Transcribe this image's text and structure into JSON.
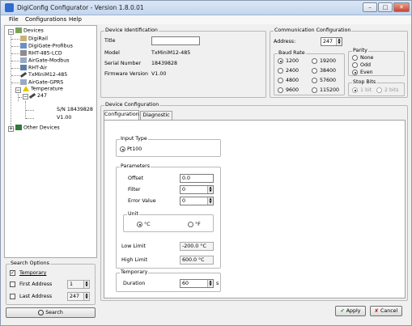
{
  "window": {
    "title": "DigiConfig Configurator - Version 1.8.0.01"
  },
  "menu": [
    "File",
    "Configurations",
    "Help"
  ],
  "tree": {
    "root": "Devices",
    "items": [
      "DigiRail",
      "DigiGate-Profibus",
      "RHT-485-LCD",
      "AirGate-Modbus",
      "RHT-Air",
      "TxMiniM12-485",
      "AirGate-GPRS"
    ],
    "temperature": "Temperature",
    "device_id": "247",
    "serial": "S/N 18439828",
    "version": "V1.00",
    "other": "Other Devices"
  },
  "search_options": {
    "title": "Search Options",
    "temporary": "Temporary",
    "first_address": "First Address",
    "first_value": "1",
    "last_address": "Last Address",
    "last_value": "247",
    "search_button": "Search"
  },
  "device_identification": {
    "title": "Device Identification",
    "title_label": "Title",
    "title_value": "",
    "model_label": "Model",
    "model_value": "TxMiniM12-485",
    "serial_label": "Serial Number",
    "serial_value": "18439828",
    "firmware_label": "Firmware Version",
    "firmware_value": "V1.00"
  },
  "communication": {
    "title": "Communication Configuration",
    "address_label": "Address:",
    "address_value": "247",
    "baud_title": "Baud Rate",
    "baud_rates": [
      "1200",
      "19200",
      "2400",
      "38400",
      "4800",
      "57600",
      "9600",
      "115200"
    ],
    "baud_selected": "1200",
    "parity_title": "Parity",
    "parity": [
      "None",
      "Odd",
      "Even"
    ],
    "parity_selected": "Even",
    "stopbits_title": "Stop Bits",
    "stopbits": [
      "1 bit",
      "2 bits"
    ]
  },
  "device_configuration": {
    "title": "Device Configuration",
    "tabs": [
      "Configuration",
      "Diagnostic"
    ],
    "input_type_title": "Input Type",
    "input_type": "Pt100",
    "parameters_title": "Parameters",
    "offset_label": "Offset",
    "offset_value": "0.0",
    "filter_label": "Filter",
    "filter_value": "0",
    "error_label": "Error Value",
    "error_value": "0",
    "unit_title": "Unit",
    "unit_c": "°C",
    "unit_f": "°F",
    "low_limit_label": "Low Limit",
    "low_limit_value": "-200.0 °C",
    "high_limit_label": "High Limit",
    "high_limit_value": "600.0 °C",
    "temporary_title": "Temporary",
    "duration_label": "Duration",
    "duration_value": "60",
    "duration_unit": "s"
  },
  "buttons": {
    "apply": "Apply",
    "cancel": "Cancel"
  },
  "colors": {
    "accent": "#2f6bd0",
    "title_bar": "#c3d6ee"
  }
}
